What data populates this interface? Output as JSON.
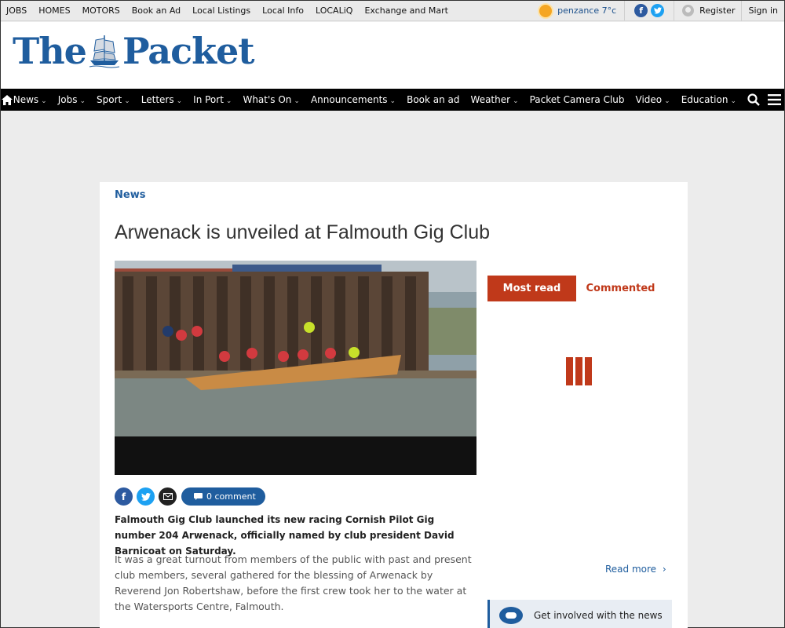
{
  "topbar": {
    "links": [
      "JOBS",
      "HOMES",
      "MOTORS",
      "Book an Ad",
      "Local Listings",
      "Local Info",
      "LOCALiQ",
      "Exchange and Mart"
    ],
    "weather": "penzance 7°c",
    "register": "Register",
    "signin": "Sign in"
  },
  "nav": {
    "items": [
      {
        "label": "News",
        "chevron": true
      },
      {
        "label": "Jobs",
        "chevron": true
      },
      {
        "label": "Sport",
        "chevron": true
      },
      {
        "label": "Letters",
        "chevron": true
      },
      {
        "label": "In Port",
        "chevron": true
      },
      {
        "label": "What's On",
        "chevron": true
      },
      {
        "label": "Announcements",
        "chevron": true
      },
      {
        "label": "Book an ad",
        "chevron": false
      },
      {
        "label": "Weather",
        "chevron": true
      },
      {
        "label": "Packet Camera Club",
        "chevron": false
      },
      {
        "label": "Video",
        "chevron": true
      },
      {
        "label": "Education",
        "chevron": true
      }
    ],
    "icons": [
      "home-icon",
      "search-icon",
      "menu-icon"
    ]
  },
  "article": {
    "section": "News",
    "headline": "Arwenack is unveiled at Falmouth Gig Club",
    "comment_label": "0 comment",
    "lead": "Falmouth Gig Club launched its new racing Cornish Pilot Gig number 204 Arwenack, officially named by club president David Barnicoat on Saturday.",
    "body": "It was a great turnout from members of the public with past and present club members, several gathered for the blessing of Arwenack by Reverend Jon Robertshaw, before the first crew took her to the water at the Watersports Centre, Falmouth."
  },
  "sidebar": {
    "tab_active": "Most read",
    "tab_other": "Commented",
    "read_more": "Read more",
    "get_involved": "Get involved with the news"
  },
  "colors": {
    "brand_blue": "#1f5d9e",
    "accent_red": "#c0391a",
    "nav_bg": "#000000"
  }
}
